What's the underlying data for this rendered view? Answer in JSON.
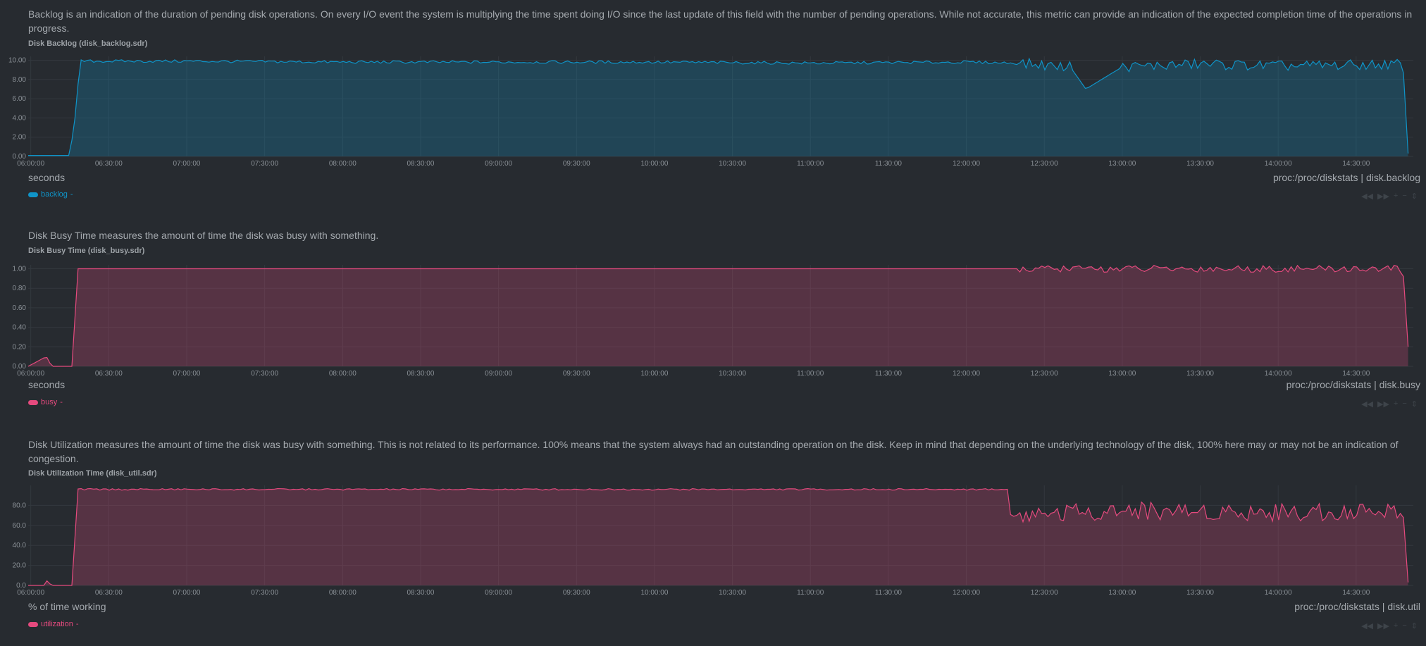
{
  "colors": {
    "background": "#272b30",
    "backlog": "#0f94c8",
    "busy": "#e54a7e",
    "utilization": "#e54a7e",
    "grid": "#33383e"
  },
  "time_ticks": [
    "06:00:00",
    "06:30:00",
    "07:00:00",
    "07:30:00",
    "08:00:00",
    "08:30:00",
    "09:00:00",
    "09:30:00",
    "10:00:00",
    "10:30:00",
    "11:00:00",
    "11:30:00",
    "12:00:00",
    "12:30:00",
    "13:00:00",
    "13:30:00",
    "14:00:00",
    "14:30:00"
  ],
  "toolbox": {
    "icons": [
      "rewind-icon",
      "fast-forward-icon",
      "zoom-in-icon",
      "zoom-out-icon",
      "resize-icon"
    ],
    "glyphs": [
      "◀◀",
      "▶▶",
      "+",
      "−",
      "⇕"
    ]
  },
  "charts": [
    {
      "id": "backlog",
      "description": "Backlog is an indication of the duration of pending disk operations. On every I/O event the system is multiplying the time spent doing I/O since the last update of this field with the number of pending operations. While not accurate, this metric can provide an indication of the expected completion time of the operations in progress.",
      "title": "Disk Backlog (disk_backlog.sdr)",
      "units": "seconds",
      "context": "proc:/proc/diskstats | disk.backlog",
      "legend": "backlog",
      "legend_suffix": "-",
      "color": "#0f94c8",
      "y_ticks": [
        "10.00",
        "8.00",
        "6.00",
        "4.00",
        "2.00",
        "0.00"
      ]
    },
    {
      "id": "busy",
      "description": "Disk Busy Time measures the amount of time the disk was busy with something.",
      "title": "Disk Busy Time (disk_busy.sdr)",
      "units": "seconds",
      "context": "proc:/proc/diskstats | disk.busy",
      "legend": "busy",
      "legend_suffix": "-",
      "color": "#e54a7e",
      "y_ticks": [
        "1.00",
        "0.80",
        "0.60",
        "0.40",
        "0.20",
        "0.00"
      ]
    },
    {
      "id": "util",
      "description": "Disk Utilization measures the amount of time the disk was busy with something. This is not related to its performance. 100% means that the system always had an outstanding operation on the disk. Keep in mind that depending on the underlying technology of the disk, 100% here may or may not be an indication of congestion.",
      "title": "Disk Utilization Time (disk_util.sdr)",
      "units": "% of time working",
      "context": "proc:/proc/diskstats | disk.util",
      "legend": "utilization",
      "legend_suffix": "-",
      "color": "#e54a7e",
      "y_ticks": [
        "80.0",
        "60.0",
        "40.0",
        "20.0",
        "0.0"
      ]
    }
  ],
  "chart_data": [
    {
      "type": "area",
      "title": "Disk Backlog (disk_backlog.sdr)",
      "ylabel": "seconds",
      "x_range": [
        "05:59:00",
        "14:52:00"
      ],
      "ylim": [
        0,
        10.4
      ],
      "series": [
        {
          "name": "backlog",
          "points": [
            [
              "05:59:00",
              0.1
            ],
            [
              "06:15:00",
              0.1
            ],
            [
              "06:17:00",
              4
            ],
            [
              "06:19:00",
              9.9
            ],
            [
              "06:30:00",
              9.9
            ],
            [
              "07:00:00",
              9.9
            ],
            [
              "08:00:00",
              9.8
            ],
            [
              "09:00:00",
              9.8
            ],
            [
              "10:00:00",
              9.8
            ],
            [
              "11:00:00",
              9.7
            ],
            [
              "12:00:00",
              9.8
            ],
            [
              "12:20:00",
              9.7
            ],
            [
              "12:40:00",
              9.3
            ],
            [
              "12:46:00",
              7.0
            ],
            [
              "13:00:00",
              9.3
            ],
            [
              "13:30:00",
              9.6
            ],
            [
              "14:00:00",
              9.4
            ],
            [
              "14:30:00",
              9.5
            ],
            [
              "14:48:00",
              9.6
            ],
            [
              "14:50:00",
              0.3
            ]
          ]
        }
      ]
    },
    {
      "type": "area",
      "title": "Disk Busy Time (disk_busy.sdr)",
      "ylabel": "seconds",
      "x_range": [
        "05:59:00",
        "14:52:00"
      ],
      "ylim": [
        0,
        1.04
      ],
      "series": [
        {
          "name": "busy",
          "points": [
            [
              "05:59:00",
              0.0
            ],
            [
              "06:06:00",
              0.1
            ],
            [
              "06:08:00",
              0.0
            ],
            [
              "06:16:00",
              0.0
            ],
            [
              "06:18:00",
              1.0
            ],
            [
              "07:00:00",
              1.0
            ],
            [
              "08:00:00",
              1.0
            ],
            [
              "09:00:00",
              1.0
            ],
            [
              "10:00:00",
              1.0
            ],
            [
              "11:00:00",
              1.0
            ],
            [
              "12:00:00",
              1.0
            ],
            [
              "12:20:00",
              1.0
            ],
            [
              "12:40:00",
              1.0
            ],
            [
              "13:00:00",
              1.0
            ],
            [
              "13:30:00",
              1.0
            ],
            [
              "14:00:00",
              1.0
            ],
            [
              "14:30:00",
              1.0
            ],
            [
              "14:48:00",
              1.0
            ],
            [
              "14:50:00",
              0.2
            ]
          ]
        }
      ]
    },
    {
      "type": "area",
      "title": "Disk Utilization Time (disk_util.sdr)",
      "ylabel": "% of time working",
      "x_range": [
        "05:59:00",
        "14:52:00"
      ],
      "ylim": [
        0,
        100
      ],
      "series": [
        {
          "name": "utilization",
          "points": [
            [
              "05:59:00",
              0
            ],
            [
              "06:05:00",
              0
            ],
            [
              "06:06:00",
              5
            ],
            [
              "06:08:00",
              0
            ],
            [
              "06:16:00",
              0
            ],
            [
              "06:18:00",
              96
            ],
            [
              "07:00:00",
              96
            ],
            [
              "08:00:00",
              96
            ],
            [
              "09:00:00",
              96
            ],
            [
              "10:00:00",
              96
            ],
            [
              "11:00:00",
              96
            ],
            [
              "12:00:00",
              96
            ],
            [
              "12:16:00",
              96
            ],
            [
              "12:17:00",
              70
            ],
            [
              "12:30:00",
              72
            ],
            [
              "13:00:00",
              75
            ],
            [
              "13:30:00",
              74
            ],
            [
              "14:00:00",
              73
            ],
            [
              "14:30:00",
              74
            ],
            [
              "14:48:00",
              75
            ],
            [
              "14:50:00",
              3
            ]
          ]
        }
      ]
    }
  ]
}
